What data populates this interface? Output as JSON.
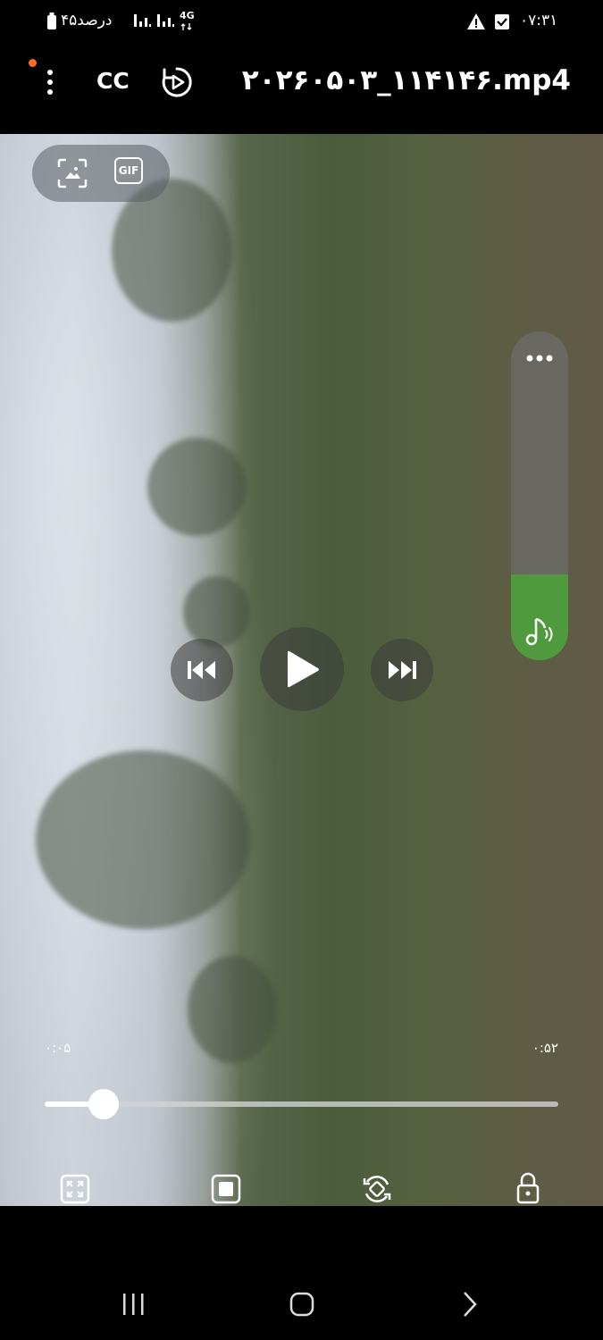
{
  "status_bar": {
    "battery_text": "۴۵درصد",
    "network": "4G",
    "time": "۰۷:۳۱"
  },
  "top_bar": {
    "cc_label": "CC",
    "file_name": "۲۰۲۶۰۵۰۳_۱۱۴۱۴۶.mp4"
  },
  "capture": {
    "gif_label": "GIF"
  },
  "playback": {
    "elapsed": "۰:۰۵",
    "duration": "۰:۵۲",
    "progress": 0.115
  },
  "volume": {
    "level": 0.26
  },
  "colors": {
    "accent": "#4e9a3c",
    "notification_dot": "#ff6a22"
  }
}
